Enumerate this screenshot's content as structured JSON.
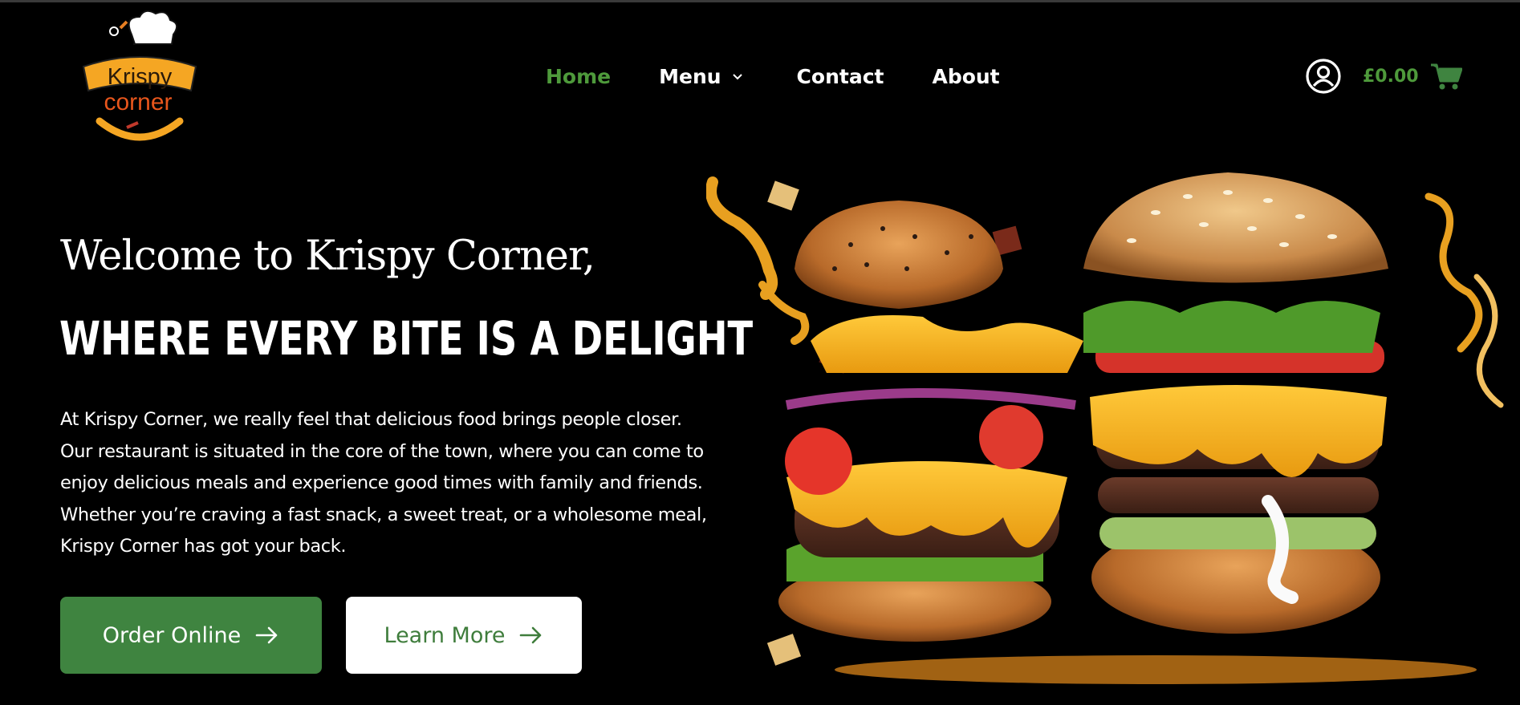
{
  "colors": {
    "background": "#000000",
    "accent_green": "#4e9a3b",
    "button_green": "#3f8440",
    "logo_orange": "#f39c12"
  },
  "logo": {
    "line1": "Krispy",
    "line2": "corner",
    "icon": "chef-hat-logo"
  },
  "nav": {
    "home": "Home",
    "menu": "Menu",
    "contact": "Contact",
    "about": "About",
    "active": "Home"
  },
  "header": {
    "account_icon": "user-circle-icon",
    "cart_total": "£0.00",
    "cart_icon": "shopping-cart-icon"
  },
  "hero": {
    "greeting": "Welcome to Krispy Corner,",
    "headline": "WHERE EVERY BITE IS A DELIGHT",
    "body_lines": [
      "At Krispy Corner, we really feel that delicious food brings people closer.",
      "Our restaurant is situated in the core of the town, where you can come to",
      "enjoy delicious meals and experience good times with family and friends.",
      "Whether you’re craving a fast snack, a sweet treat, or a wholesome meal,",
      "Krispy Corner has got your back."
    ],
    "order_button": "Order Online",
    "learn_button": "Learn More"
  }
}
